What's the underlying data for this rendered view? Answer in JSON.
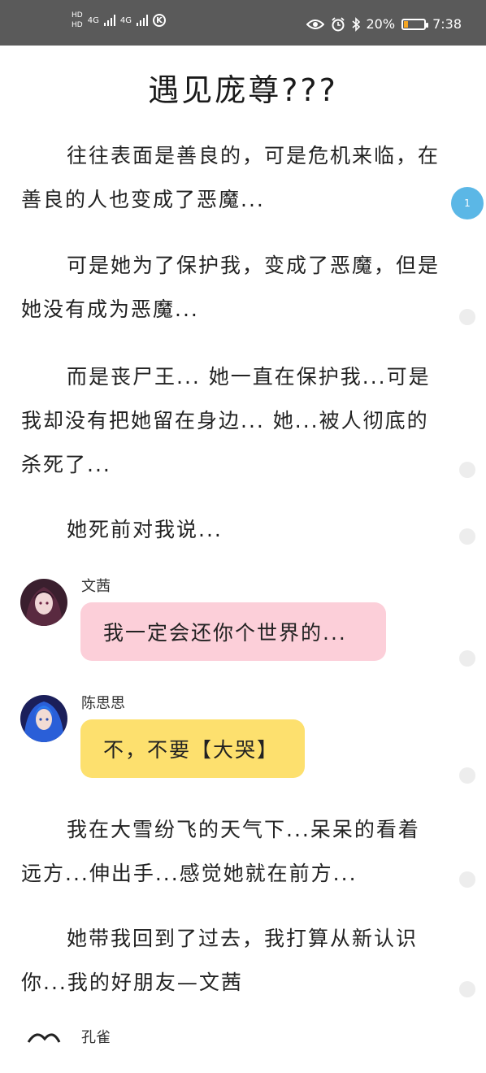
{
  "status_bar": {
    "hd1": "HD",
    "hd2": "HD",
    "net1": "4G",
    "net2": "4G",
    "battery_text": "20%",
    "battery_level": 0.2,
    "time": "7:38",
    "colors": {
      "background": "#5a5a5a",
      "battery": "#f5a623"
    },
    "icons": [
      "signal-icon",
      "k-app-icon",
      "eye-icon",
      "alarm-icon",
      "bluetooth-icon",
      "battery-icon"
    ]
  },
  "article": {
    "title": "遇见庞尊???",
    "p1": "往往表面是善良的，可是危机来临，在善良的人也变成了恶魔...",
    "p2": "可是她为了保护我，变成了恶魔，但是她没有成为恶魔...",
    "p3": "而是丧尸王... 她一直在保护我...可是我却没有把她留在身边... 她...被人彻底的杀死了...",
    "p4": "她死前对我说...",
    "dialog1": {
      "name": "文茜",
      "text": "我一定会还你个世界的...",
      "bubble_color": "#fccfd9"
    },
    "dialog2": {
      "name": "陈思思",
      "text": "不，不要【大哭】",
      "bubble_color": "#fde06e"
    },
    "p5": "我在大雪纷飞的天气下...呆呆的看着远方...伸出手...感觉她就在前方...",
    "p6": "她带我回到了过去，我打算从新认识你...我的好朋友—文茜",
    "dialog3_name": "孔雀"
  },
  "side_nav": {
    "active_label": "1",
    "accent": "#5bb7e6"
  }
}
